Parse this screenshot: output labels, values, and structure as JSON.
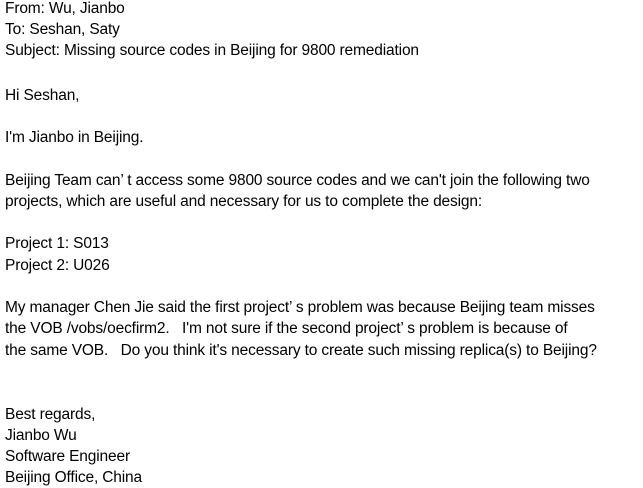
{
  "header": {
    "from": "From: Wu, Jianbo",
    "to": "To: Seshan, Saty",
    "subject": "Subject: Missing source codes in Beijing for 9800 remediation"
  },
  "body": {
    "greeting": "Hi Seshan,",
    "intro": "I'm Jianbo in Beijing.",
    "para1": [
      "Beijing Team can’ t access some 9800 source codes and we can't join the following two",
      "projects, which are useful and necessary for us to complete the design:"
    ],
    "projects": [
      "Project 1: S013",
      "Project 2: U026"
    ],
    "para2": [
      "My manager Chen Jie said the first project’ s problem was because Beijing team misses",
      "the VOB /vobs/oecfirm2.   I'm not sure if the second project’ s problem is because of",
      "the same VOB.   Do you think it's necessary to create such missing replica(s) to Beijing?"
    ]
  },
  "signature": {
    "closing": "Best regards,",
    "name": "Jianbo Wu",
    "title": "Software Engineer",
    "office": "Beijing Office, China"
  }
}
